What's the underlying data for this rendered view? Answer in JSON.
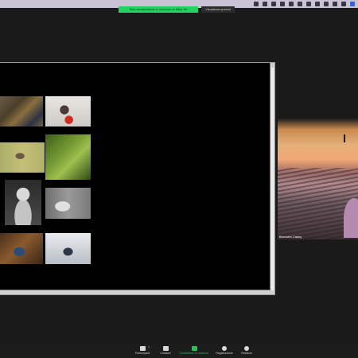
{
  "top_bar": {
    "share_banner": "Stai visualizzando lo schermo di Mike Sri",
    "view_options": "Visualizza opzioni"
  },
  "shared_screen": {
    "photos": [
      {
        "name": "photo-market-scene"
      },
      {
        "name": "photo-child-with-red-object"
      },
      {
        "name": "photo-bird-on-branch"
      },
      {
        "name": "photo-leaf-closeup"
      },
      {
        "name": "photo-portrait-ruffled-collar"
      },
      {
        "name": "photo-seated-figures"
      },
      {
        "name": "photo-person-in-interior"
      },
      {
        "name": "photo-figure-in-snow"
      }
    ]
  },
  "participant": {
    "name": "Bronwen Casey"
  },
  "toolbar": {
    "participants_label": "Partecipanti",
    "participants_count": "7",
    "chat_label": "Chattare",
    "share_label": "Condividere lo schermo",
    "record_label": "Registrazione",
    "reactions_label": "Reazioni"
  },
  "colors": {
    "share_green": "#23d160",
    "toolbar_bg": "#1c1c1c",
    "page_bg": "#1a1a1a"
  }
}
